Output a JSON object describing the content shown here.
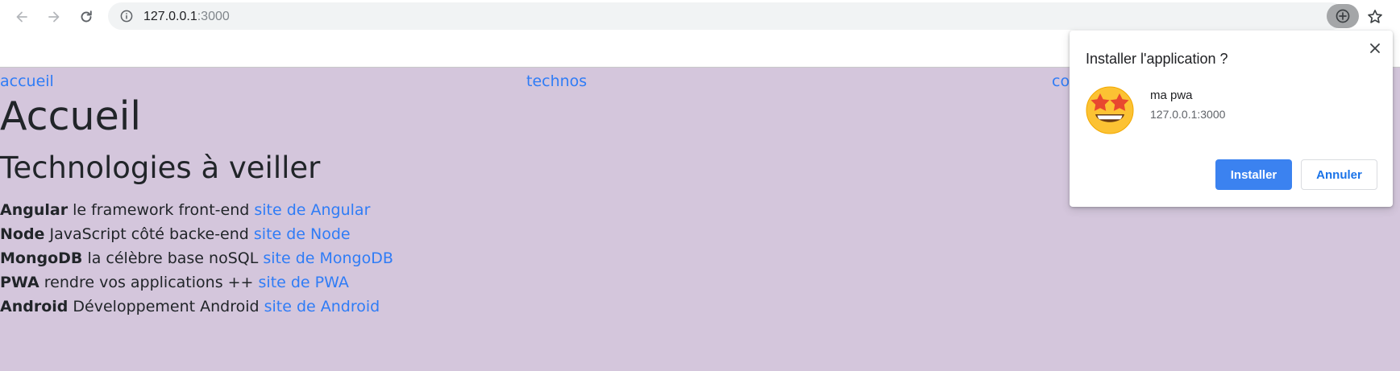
{
  "browser": {
    "url_host": "127.0.0.1",
    "url_port": ":3000",
    "icons": {
      "back": "arrow-left-icon",
      "forward": "arrow-right-icon",
      "reload": "reload-icon",
      "site_info": "info-icon",
      "install": "install-app-icon",
      "bookmark": "star-icon"
    }
  },
  "page": {
    "background": "#d4c6dc",
    "link_color": "#2f7cf6",
    "nav": [
      {
        "label": "accueil"
      },
      {
        "label": "technos"
      },
      {
        "label": "co"
      }
    ],
    "heading": "Accueil",
    "subheading": "Technologies à veiller",
    "techs": [
      {
        "name": "Angular",
        "description": " le framework front-end ",
        "link": "site de Angular"
      },
      {
        "name": "Node",
        "description": " JavaScript côté backe-end ",
        "link": "site de Node"
      },
      {
        "name": "MongoDB",
        "description": " la célèbre base noSQL ",
        "link": "site de MongoDB"
      },
      {
        "name": "PWA",
        "description": " rendre vos applications ++ ",
        "link": "site de PWA"
      },
      {
        "name": "Android",
        "description": " Développement Android ",
        "link": "site de Android"
      }
    ]
  },
  "install_dialog": {
    "title": "Installer l'application ?",
    "app_name": "ma pwa",
    "app_origin": "127.0.0.1:3000",
    "app_icon": "star-struck-emoji-icon",
    "install_label": "Installer",
    "cancel_label": "Annuler",
    "accent": "#3b82f0"
  }
}
